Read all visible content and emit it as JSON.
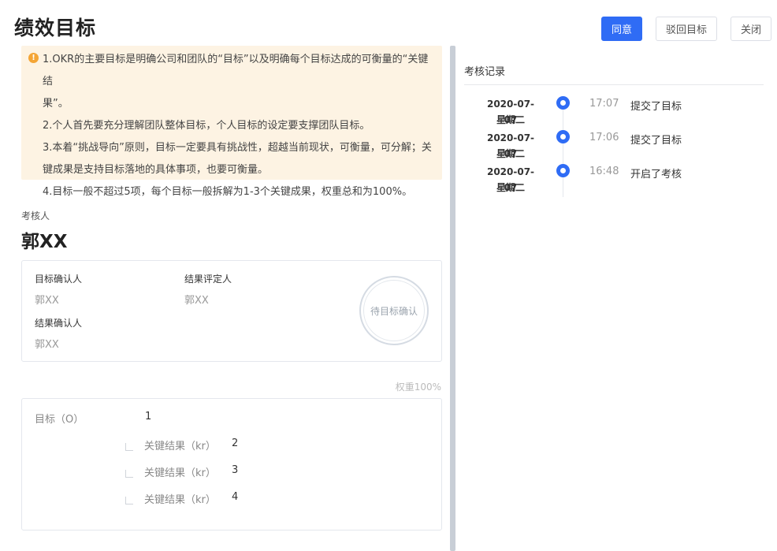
{
  "header": {
    "title": "绩效目标",
    "approve_label": "同意",
    "reject_label": "驳回目标",
    "close_label": "关闭"
  },
  "notice": {
    "icon": "warning-icon",
    "lines": [
      "1.OKR的主要目标是明确公司和团队的“目标”以及明确每个目标达成的可衡量的“关键结",
      "果”。",
      "2.个人首先要充分理解团队整体目标，个人目标的设定要支撑团队目标。",
      "3.本着“挑战导向”原则，目标一定要具有挑战性，超越当前现状，可衡量，可分解；关",
      "键成果是支持目标落地的具体事项，也要可衡量。",
      "4.目标一般不超过5项，每个目标一般拆解为1-3个关键成果，权重总和为100%。"
    ]
  },
  "assessor": {
    "label": "考核人",
    "name": "郭XX"
  },
  "confirm": {
    "target_confirmer_label": "目标确认人",
    "target_confirmer_value": "郭XX",
    "result_evaluator_label": "结果评定人",
    "result_evaluator_value": "郭XX",
    "result_confirmer_label": "结果确认人",
    "result_confirmer_value": "郭XX",
    "stamp_text": "待目标确认"
  },
  "weight_text": "权重100%",
  "okr": {
    "objective_label": "目标（O）",
    "objective_value": "1",
    "key_results": [
      {
        "label": "关键结果（kr）",
        "value": "2"
      },
      {
        "label": "关键结果（kr）",
        "value": "3"
      },
      {
        "label": "关键结果（kr）",
        "value": "4"
      }
    ]
  },
  "records": {
    "title": "考核记录",
    "items": [
      {
        "date": "2020-07-07",
        "weekday": "星期二",
        "time": "17:07",
        "action": "提交了目标"
      },
      {
        "date": "2020-07-07",
        "weekday": "星期二",
        "time": "17:06",
        "action": "提交了目标"
      },
      {
        "date": "2020-07-07",
        "weekday": "星期二",
        "time": "16:48",
        "action": "开启了考核"
      }
    ]
  },
  "colors": {
    "primary": "#2f6cf5",
    "notice_bg": "#fdf3e3",
    "warning": "#f4a535"
  }
}
